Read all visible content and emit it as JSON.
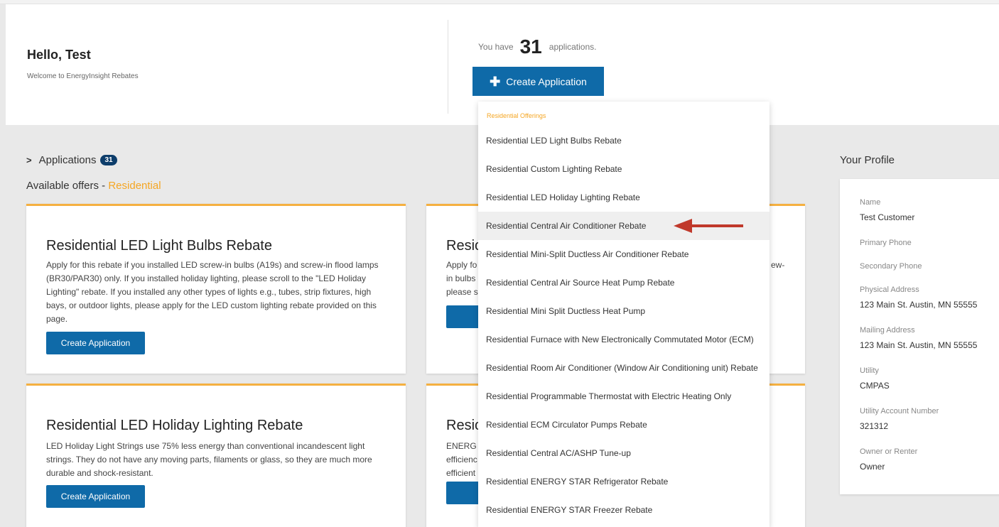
{
  "header": {
    "greeting": "Hello, Test",
    "welcome": "Welcome to EnergyInsight Rebates",
    "count_prefix": "You have",
    "count": "31",
    "count_suffix": "applications.",
    "create_button": "Create Application"
  },
  "applications": {
    "label": "Applications",
    "badge": "31"
  },
  "available": {
    "prefix": "Available offers - ",
    "category": "Residential"
  },
  "cards": [
    {
      "title": "Residential LED Light Bulbs Rebate",
      "body": "Apply for this rebate if you installed LED screw-in bulbs (A19s) and screw-in flood lamps (BR30/PAR30) only. If you installed holiday lighting, please scroll to the \"LED Holiday Lighting\" rebate. If you installed any other types of lights e.g., tubes, strip fixtures, high bays, or outdoor lights, please apply for the LED custom lighting rebate provided on this page.",
      "button": "Create Application"
    },
    {
      "title": "Resic",
      "body_lines": [
        "Apply fo",
        "in bulbs",
        "please s"
      ],
      "body_right": "ew-",
      "button": "Crea"
    },
    {
      "title": "Residential LED Holiday Lighting Rebate",
      "body": "LED Holiday Light Strings use 75% less energy than conventional incandescent light strings. They do not have any moving parts, filaments or glass, so they are much more durable and shock-resistant.",
      "button": "Create Application"
    },
    {
      "title": "Resic",
      "body_lines": [
        "ENERG",
        "efficienc",
        "efficient"
      ],
      "button": "Crea"
    }
  ],
  "profile": {
    "title": "Your Profile",
    "fields": [
      {
        "label": "Name",
        "value": "Test Customer"
      },
      {
        "label": "Primary Phone",
        "value": ""
      },
      {
        "label": "Secondary Phone",
        "value": ""
      },
      {
        "label": "Physical Address",
        "value": "123 Main St. Austin, MN 55555"
      },
      {
        "label": "Mailing Address",
        "value": "123 Main St. Austin, MN 55555"
      },
      {
        "label": "Utility",
        "value": "CMPAS"
      },
      {
        "label": "Utility Account Number",
        "value": "321312"
      },
      {
        "label": "Owner or Renter",
        "value": "Owner"
      }
    ]
  },
  "dropdown": {
    "header": "Residential Offerings",
    "items": [
      "Residential LED Light Bulbs Rebate",
      "Residential Custom Lighting Rebate",
      "Residential LED Holiday Lighting Rebate",
      "Residential Central Air Conditioner Rebate",
      "Residential Mini-Split Ductless Air Conditioner Rebate",
      "Residential Central Air Source Heat Pump Rebate",
      "Residential Mini Split Ductless Heat Pump",
      "Residential Furnace with New Electronically Commutated Motor (ECM)",
      "Residential Room Air Conditioner (Window Air Conditioning unit) Rebate",
      "Residential Programmable Thermostat with Electric Heating Only",
      "Residential ECM Circulator Pumps Rebate",
      "Residential Central AC/ASHP Tune-up",
      "Residential ENERGY STAR Refrigerator Rebate",
      "Residential ENERGY STAR Freezer Rebate"
    ],
    "highlighted_item": "Residential Central Air Conditioner Rebate"
  },
  "colors": {
    "primary_button": "#0f6aa8",
    "accent_orange": "#f5a623",
    "card_top_border": "#f5b041",
    "annotation_arrow": "#c0392b",
    "badge": "#0d3d6b"
  },
  "icons": {
    "plus": "plus-icon",
    "chevron": "chevron-right-icon",
    "annotation": "red-arrow-icon"
  }
}
